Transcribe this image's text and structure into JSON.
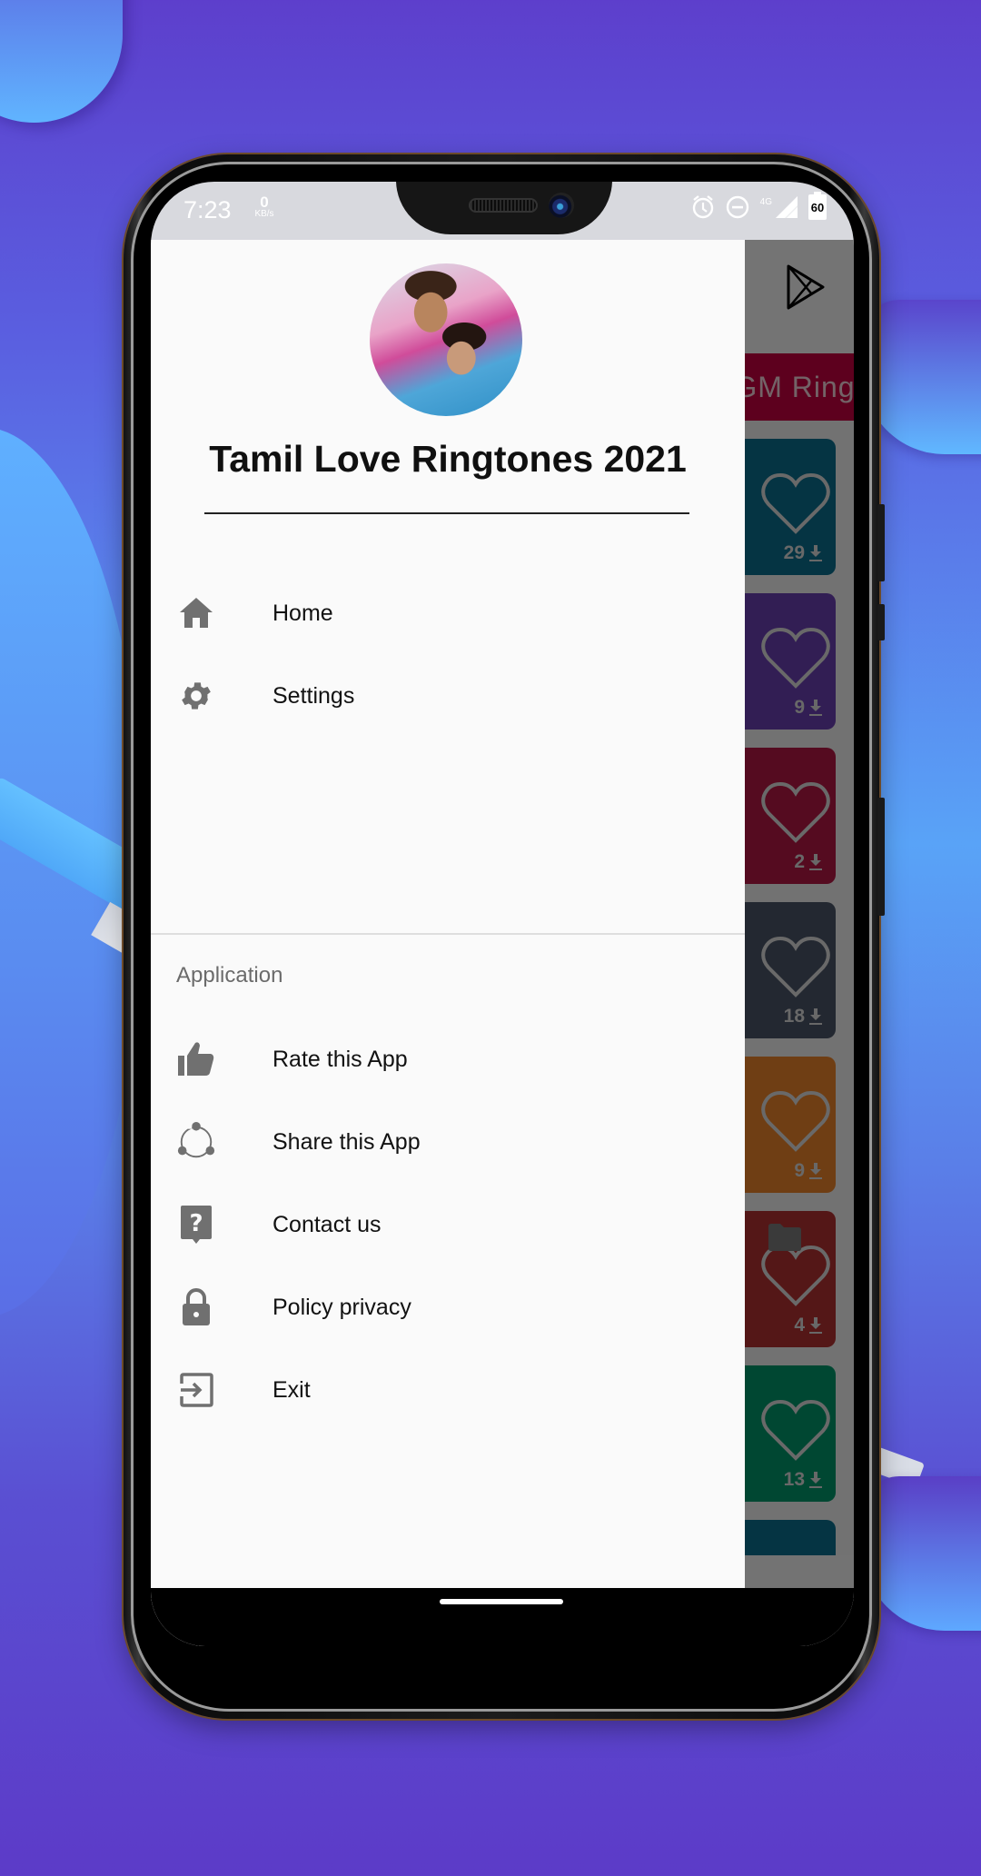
{
  "status_bar": {
    "time": "7:23",
    "net_speed_value": "0",
    "net_speed_unit": "KB/s",
    "network_type": "4G",
    "battery_level": "60",
    "icons": [
      "alarm-icon",
      "do-not-disturb-icon",
      "signal-icon",
      "battery-icon"
    ]
  },
  "drawer": {
    "app_title": "Tamil Love Ringtones 2021",
    "avatar_icon": "couple-photo",
    "primary_items": [
      {
        "label": "Home",
        "icon": "home-icon"
      },
      {
        "label": "Settings",
        "icon": "gear-icon"
      }
    ],
    "section_label": "Application",
    "secondary_items": [
      {
        "label": "Rate this App",
        "icon": "thumbs-up-icon"
      },
      {
        "label": "Share this App",
        "icon": "share-icon"
      },
      {
        "label": "Contact us",
        "icon": "help-icon"
      },
      {
        "label": "Policy privacy",
        "icon": "lock-icon"
      },
      {
        "label": "Exit",
        "icon": "exit-icon"
      }
    ]
  },
  "background_app": {
    "top_icon": "play-store-icon",
    "banner_text": "BGM Ringtones",
    "ringtone_cards": [
      {
        "downloads": "29",
        "color": "#0b6e8c"
      },
      {
        "downloads": "9",
        "color": "#6a3fb0"
      },
      {
        "downloads": "2",
        "color": "#b21844"
      },
      {
        "downloads": "18",
        "color": "#4a5566"
      },
      {
        "downloads": "9",
        "color": "#e9822a"
      },
      {
        "downloads": "4",
        "color": "#b03030"
      },
      {
        "downloads": "13",
        "color": "#00956a"
      },
      {
        "downloads": "",
        "color": "#0b6e8c"
      }
    ],
    "bottom_icon": "folder-icon"
  },
  "colors": {
    "drawer_bg": "#fafafa",
    "icon_gray": "#707070",
    "banner": "#c2003f"
  }
}
